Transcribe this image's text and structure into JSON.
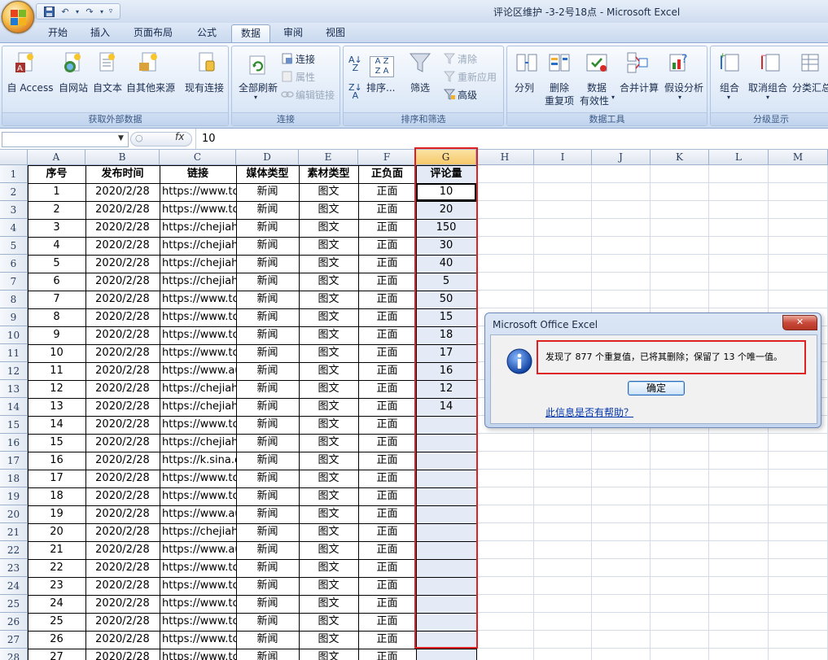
{
  "window_title": "评论区维护 -3-2号18点 - Microsoft Excel",
  "tabs": [
    {
      "label": "开始"
    },
    {
      "label": "插入"
    },
    {
      "label": "页面布局"
    },
    {
      "label": "公式"
    },
    {
      "label": "数据",
      "active": true
    },
    {
      "label": "审阅"
    },
    {
      "label": "视图"
    }
  ],
  "ribbon": {
    "groups": {
      "external": "获取外部数据",
      "connections": "连接",
      "sort_filter": "排序和筛选",
      "data_tools": "数据工具",
      "outline": "分级显示"
    },
    "buttons": {
      "access": "自 Access",
      "web": "自网站",
      "text": "自文本",
      "other_sources": "自其他来源",
      "existing_conn": "现有连接",
      "refresh_all": "全部刷新",
      "connections": "连接",
      "properties": "属性",
      "edit_links": "编辑链接",
      "sort": "排序...",
      "filter": "筛选",
      "clear": "清除",
      "reapply": "重新应用",
      "advanced": "高级",
      "text_to_columns": "分列",
      "remove_dup_1": "删除",
      "remove_dup_2": "重复项",
      "validation_1": "数据",
      "validation_2": "有效性",
      "consolidate": "合并计算",
      "whatif": "假设分析",
      "group": "组合",
      "ungroup": "取消组合",
      "subtotal": "分类汇总"
    }
  },
  "formula_bar": {
    "fx": "fx",
    "value": "10"
  },
  "columns": [
    "A",
    "B",
    "C",
    "D",
    "E",
    "F",
    "G",
    "H",
    "I",
    "J",
    "K",
    "L",
    "M"
  ],
  "headers": [
    "序号",
    "发布时间",
    "链接",
    "媒体类型",
    "素材类型",
    "正负面",
    "评论量"
  ],
  "rows": [
    [
      "1",
      "2020/2/28",
      "https://www.tc",
      "新闻",
      "图文",
      "正面",
      "10"
    ],
    [
      "2",
      "2020/2/28",
      "https://www.tc",
      "新闻",
      "图文",
      "正面",
      "20"
    ],
    [
      "3",
      "2020/2/28",
      "https://chejiah",
      "新闻",
      "图文",
      "正面",
      "150"
    ],
    [
      "4",
      "2020/2/28",
      "https://chejiah",
      "新闻",
      "图文",
      "正面",
      "30"
    ],
    [
      "5",
      "2020/2/28",
      "https://chejiah",
      "新闻",
      "图文",
      "正面",
      "40"
    ],
    [
      "6",
      "2020/2/28",
      "https://chejiah",
      "新闻",
      "图文",
      "正面",
      "5"
    ],
    [
      "7",
      "2020/2/28",
      "https://www.tc",
      "新闻",
      "图文",
      "正面",
      "50"
    ],
    [
      "8",
      "2020/2/28",
      "https://www.tc",
      "新闻",
      "图文",
      "正面",
      "15"
    ],
    [
      "9",
      "2020/2/28",
      "https://www.tc",
      "新闻",
      "图文",
      "正面",
      "18"
    ],
    [
      "10",
      "2020/2/28",
      "https://www.tc",
      "新闻",
      "图文",
      "正面",
      "17"
    ],
    [
      "11",
      "2020/2/28",
      "https://www.au",
      "新闻",
      "图文",
      "正面",
      "16"
    ],
    [
      "12",
      "2020/2/28",
      "https://chejiah",
      "新闻",
      "图文",
      "正面",
      "12"
    ],
    [
      "13",
      "2020/2/28",
      "https://chejiah",
      "新闻",
      "图文",
      "正面",
      "14"
    ],
    [
      "14",
      "2020/2/28",
      "https://www.tc",
      "新闻",
      "图文",
      "正面",
      ""
    ],
    [
      "15",
      "2020/2/28",
      "https://chejiah",
      "新闻",
      "图文",
      "正面",
      ""
    ],
    [
      "16",
      "2020/2/28",
      "https://k.sina.c",
      "新闻",
      "图文",
      "正面",
      ""
    ],
    [
      "17",
      "2020/2/28",
      "https://www.tc",
      "新闻",
      "图文",
      "正面",
      ""
    ],
    [
      "18",
      "2020/2/28",
      "https://www.tc",
      "新闻",
      "图文",
      "正面",
      ""
    ],
    [
      "19",
      "2020/2/28",
      "https://www.au",
      "新闻",
      "图文",
      "正面",
      ""
    ],
    [
      "20",
      "2020/2/28",
      "https://chejiah",
      "新闻",
      "图文",
      "正面",
      ""
    ],
    [
      "21",
      "2020/2/28",
      "https://www.au",
      "新闻",
      "图文",
      "正面",
      ""
    ],
    [
      "22",
      "2020/2/28",
      "https://www.tc",
      "新闻",
      "图文",
      "正面",
      ""
    ],
    [
      "23",
      "2020/2/28",
      "https://www.tc",
      "新闻",
      "图文",
      "正面",
      ""
    ],
    [
      "24",
      "2020/2/28",
      "https://www.tc",
      "新闻",
      "图文",
      "正面",
      ""
    ],
    [
      "25",
      "2020/2/28",
      "https://www.tc",
      "新闻",
      "图文",
      "正面",
      ""
    ],
    [
      "26",
      "2020/2/28",
      "https://www.tc",
      "新闻",
      "图文",
      "正面",
      ""
    ],
    [
      "27",
      "2020/2/28",
      "https://www.tc",
      "新闻",
      "图文",
      "正面",
      ""
    ]
  ],
  "dialog": {
    "title": "Microsoft Office Excel",
    "message": "发现了 877 个重复值，已将其删除；保留了 13 个唯一值。",
    "ok": "确定",
    "help": "此信息是否有帮助？"
  },
  "colors": {
    "highlight": "#e02020",
    "selected_column": "#e4ebf6"
  }
}
